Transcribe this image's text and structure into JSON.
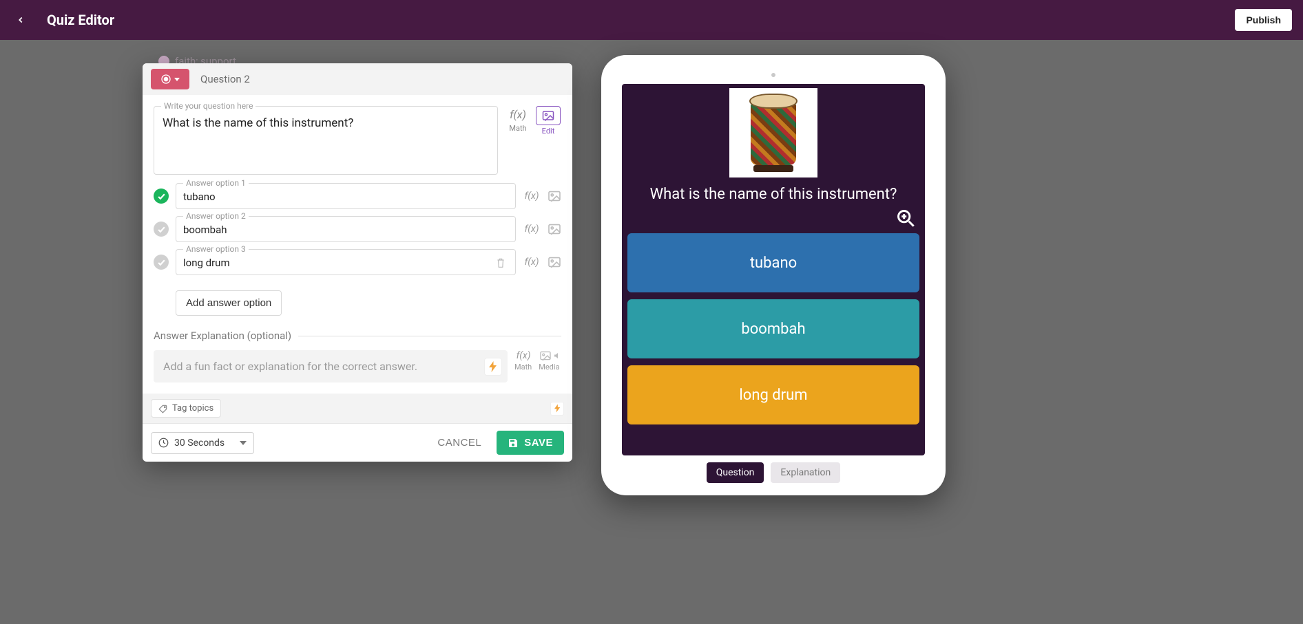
{
  "header": {
    "title": "Quiz Editor",
    "publish_label": "Publish"
  },
  "background_hint": "faith; support",
  "editor": {
    "question_label": "Question 2",
    "question_placeholder": "Write your question here",
    "question_text": "What is the name of this instrument?",
    "math_label": "Math",
    "edit_label": "Edit",
    "answers": [
      {
        "label": "Answer option 1",
        "value": "tubano",
        "correct": true,
        "show_trash": false
      },
      {
        "label": "Answer option 2",
        "value": "boombah",
        "correct": false,
        "show_trash": false
      },
      {
        "label": "Answer option 3",
        "value": "long drum",
        "correct": false,
        "show_trash": true
      }
    ],
    "add_option_label": "Add answer option",
    "explanation_heading": "Answer Explanation (optional)",
    "explanation_placeholder": "Add a fun fact or explanation for the correct answer.",
    "explain_math_label": "Math",
    "explain_media_label": "Media",
    "tag_label": "Tag topics",
    "time_label": "30 Seconds",
    "cancel_label": "CANCEL",
    "save_label": "SAVE"
  },
  "preview": {
    "question_text": "What is the name of this instrument?",
    "options": [
      {
        "text": "tubano",
        "color": "blue"
      },
      {
        "text": "boombah",
        "color": "teal"
      },
      {
        "text": "long drum",
        "color": "yellow"
      }
    ],
    "tab_question": "Question",
    "tab_explanation": "Explanation"
  }
}
